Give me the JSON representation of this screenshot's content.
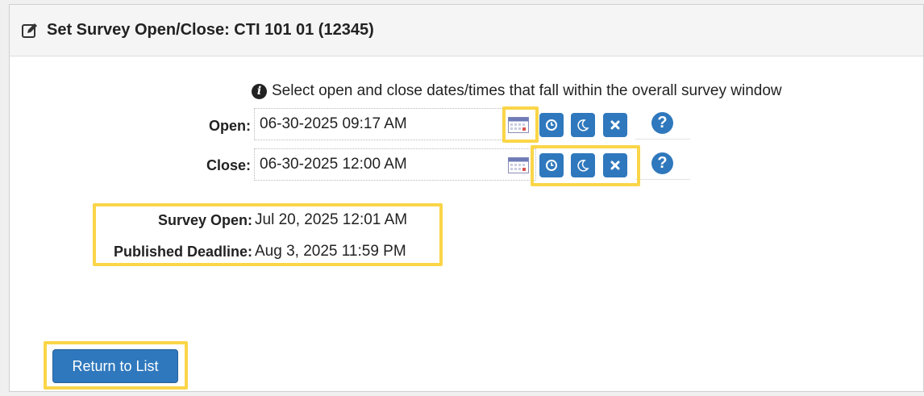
{
  "header": {
    "title": "Set Survey Open/Close: CTI 101 01 (12345)"
  },
  "info": {
    "message": "Select open and close dates/times that fall within the overall survey window"
  },
  "open": {
    "label": "Open:",
    "value": "06-30-2025 09:17 AM"
  },
  "close": {
    "label": "Close:",
    "value": "06-30-2025 12:00 AM"
  },
  "summary": {
    "survey_open_label": "Survey Open:",
    "survey_open_value": "Jul 20, 2025 12:01 AM",
    "deadline_label": "Published Deadline:",
    "deadline_value": "Aug 3, 2025 11:59 PM"
  },
  "actions": {
    "return_label": "Return to List"
  },
  "icons": {
    "header": "edit-icon",
    "info": "info-icon",
    "calendar": "calendar-icon",
    "now": "clock-icon",
    "end_of_day": "moon-icon",
    "clear": "close-icon",
    "help": "help-icon"
  },
  "colors": {
    "accent": "#2f78bd",
    "highlight": "#fad548"
  }
}
